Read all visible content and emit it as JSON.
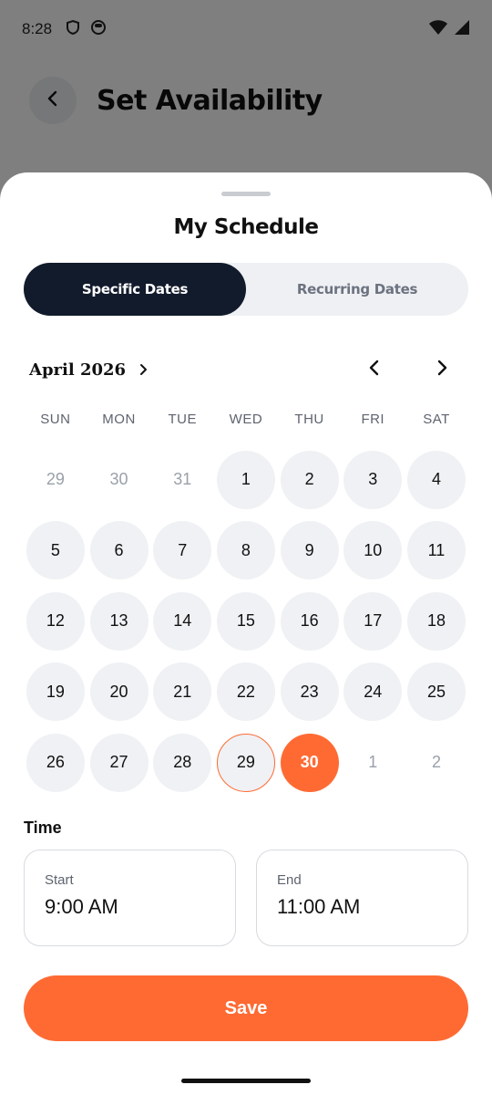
{
  "status_bar": {
    "time": "8:28",
    "icons": [
      "shield-icon",
      "face-icon"
    ],
    "right_icons": [
      "wifi-icon",
      "signal-icon"
    ]
  },
  "background_page": {
    "back_icon": "chevron-left-icon",
    "title": "Set Availability"
  },
  "sheet": {
    "title": "My Schedule",
    "tabs": [
      {
        "label": "Specific Dates",
        "active": true
      },
      {
        "label": "Recurring Dates",
        "active": false
      }
    ],
    "calendar": {
      "month_label": "April 2026",
      "weekdays": [
        "SUN",
        "MON",
        "TUE",
        "WED",
        "THU",
        "FRI",
        "SAT"
      ],
      "weeks": [
        [
          {
            "label": "29",
            "state": "muted"
          },
          {
            "label": "30",
            "state": "muted"
          },
          {
            "label": "31",
            "state": "muted"
          },
          {
            "label": "1",
            "state": "normal"
          },
          {
            "label": "2",
            "state": "normal"
          },
          {
            "label": "3",
            "state": "normal"
          },
          {
            "label": "4",
            "state": "normal"
          }
        ],
        [
          {
            "label": "5",
            "state": "normal"
          },
          {
            "label": "6",
            "state": "normal"
          },
          {
            "label": "7",
            "state": "normal"
          },
          {
            "label": "8",
            "state": "normal"
          },
          {
            "label": "9",
            "state": "normal"
          },
          {
            "label": "10",
            "state": "normal"
          },
          {
            "label": "11",
            "state": "normal"
          }
        ],
        [
          {
            "label": "12",
            "state": "normal"
          },
          {
            "label": "13",
            "state": "normal"
          },
          {
            "label": "14",
            "state": "normal"
          },
          {
            "label": "15",
            "state": "normal"
          },
          {
            "label": "16",
            "state": "normal"
          },
          {
            "label": "17",
            "state": "normal"
          },
          {
            "label": "18",
            "state": "normal"
          }
        ],
        [
          {
            "label": "19",
            "state": "normal"
          },
          {
            "label": "20",
            "state": "normal"
          },
          {
            "label": "21",
            "state": "normal"
          },
          {
            "label": "22",
            "state": "normal"
          },
          {
            "label": "23",
            "state": "normal"
          },
          {
            "label": "24",
            "state": "normal"
          },
          {
            "label": "25",
            "state": "normal"
          }
        ],
        [
          {
            "label": "26",
            "state": "normal"
          },
          {
            "label": "27",
            "state": "normal"
          },
          {
            "label": "28",
            "state": "normal"
          },
          {
            "label": "29",
            "state": "today"
          },
          {
            "label": "30",
            "state": "selected"
          },
          {
            "label": "1",
            "state": "muted"
          },
          {
            "label": "2",
            "state": "muted"
          }
        ]
      ]
    },
    "time": {
      "section_label": "Time",
      "start_label": "Start",
      "start_value": "9:00 AM",
      "end_label": "End",
      "end_value": "11:00 AM"
    },
    "save_label": "Save"
  },
  "colors": {
    "accent": "#ff6a33",
    "tab_active_bg": "#121b2c",
    "day_bg": "#eff1f4"
  }
}
